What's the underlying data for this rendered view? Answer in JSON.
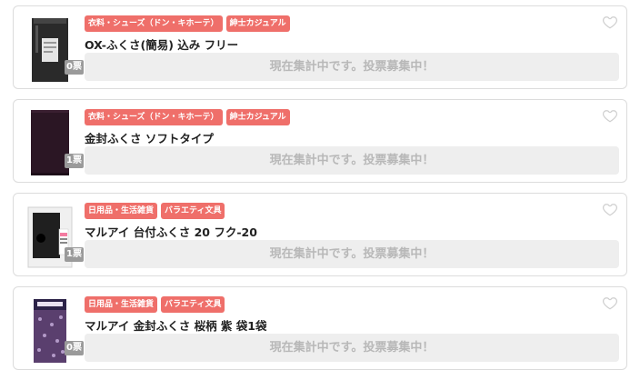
{
  "items": [
    {
      "tags": [
        "衣料・シューズ（ドン・キホーテ）",
        "紳士カジュアル"
      ],
      "title": "OX-ふくさ(簡易) 込み フリー",
      "votes": "0票",
      "status": "現在集計中です。投票募集中！",
      "thumb": "black-pouch-with-label"
    },
    {
      "tags": [
        "衣料・シューズ（ドン・キホーテ）",
        "紳士カジュアル"
      ],
      "title": "金封ふくさ ソフトタイプ",
      "votes": "1票",
      "status": "現在集計中です。投票募集中！",
      "thumb": "purple-cloth"
    },
    {
      "tags": [
        "日用品・生活雑貨",
        "バラエティ文具"
      ],
      "title": "マルアイ 台付ふくさ 20 フク-20",
      "votes": "1票",
      "status": "現在集計中です。投票募集中！",
      "thumb": "black-case-package"
    },
    {
      "tags": [
        "日用品・生活雑貨",
        "バラエティ文具"
      ],
      "title": "マルアイ 金封ふくさ 桜柄 紫 袋1袋",
      "votes": "0票",
      "status": "現在集計中です。投票募集中！",
      "thumb": "purple-sakura-pattern"
    }
  ],
  "colors": {
    "tag_bg": "#ef6f6a",
    "status_bg": "#eeeeee",
    "status_text": "#b8b8b8",
    "votes_bg": "#9a9a9a"
  }
}
